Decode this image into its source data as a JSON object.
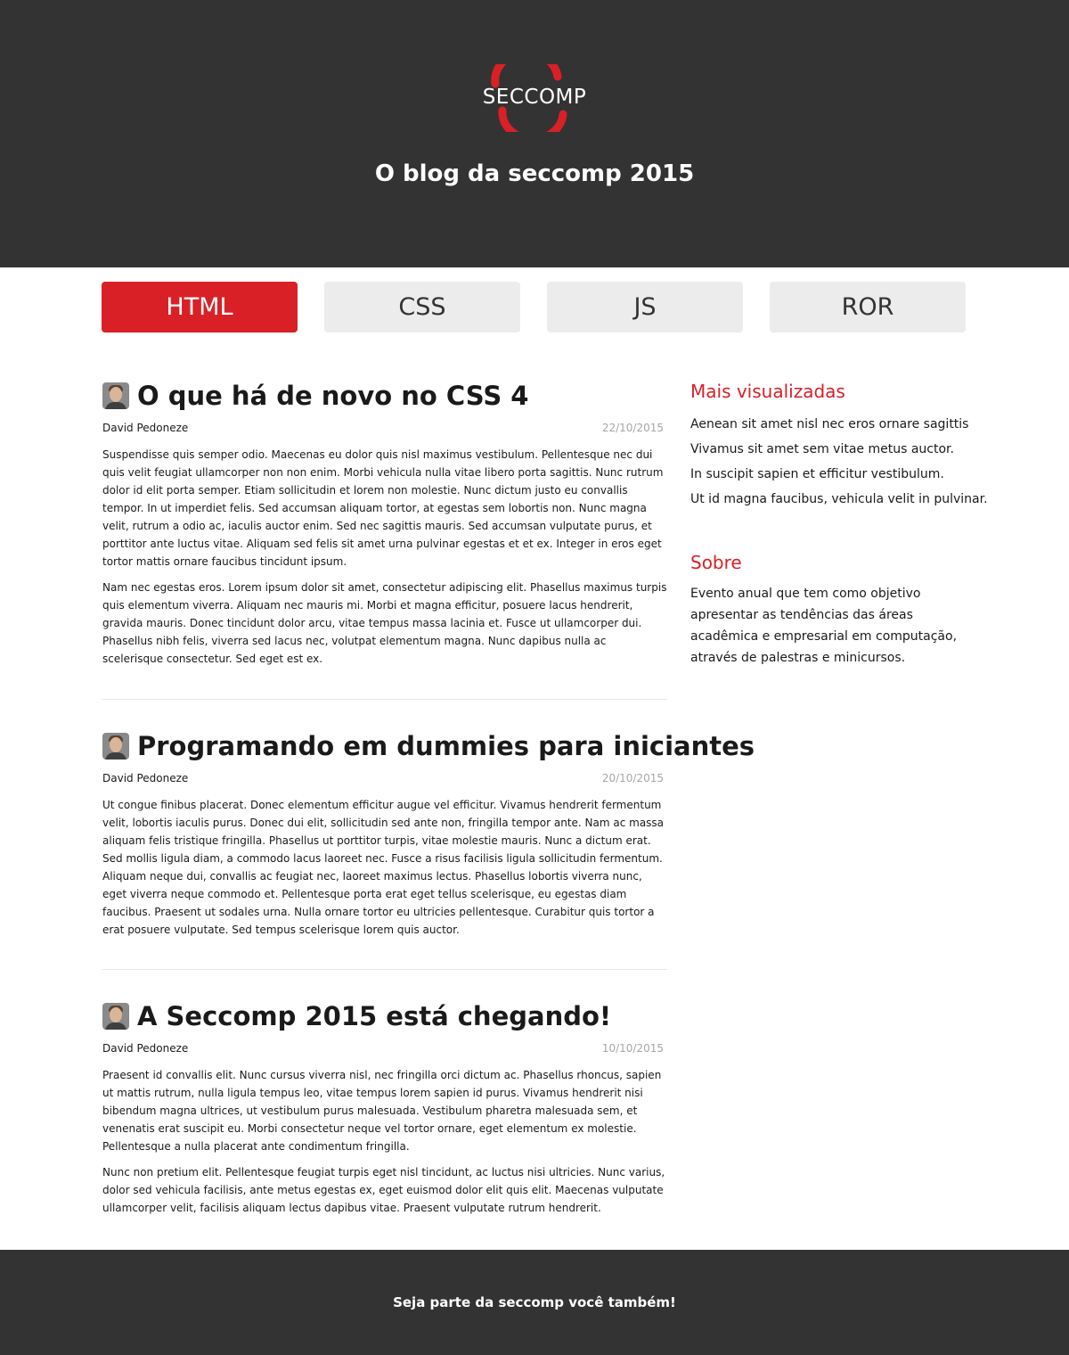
{
  "header": {
    "logo_text": "SECCOMP",
    "blog_title": "O blog da seccomp 2015"
  },
  "colors": {
    "accent": "#d92027",
    "dark": "#333333",
    "tab_inactive": "#ececec"
  },
  "nav": {
    "tabs": [
      {
        "label": "HTML",
        "active": true
      },
      {
        "label": "CSS",
        "active": false
      },
      {
        "label": "JS",
        "active": false
      },
      {
        "label": "ROR",
        "active": false
      }
    ]
  },
  "posts": [
    {
      "title": "O que há de novo no CSS 4",
      "author": "David Pedoneze",
      "date": "22/10/2015",
      "paragraphs": [
        "Suspendisse quis semper odio. Maecenas eu dolor quis nisl maximus vestibulum. Pellentesque nec dui quis velit feugiat ullamcorper non non enim. Morbi vehicula nulla vitae libero porta sagittis. Nunc rutrum dolor id elit porta semper. Etiam sollicitudin et lorem non molestie. Nunc dictum justo eu convallis tempor. In ut imperdiet felis. Sed accumsan aliquam tortor, at egestas sem lobortis non. Nunc magna velit, rutrum a odio ac, iaculis auctor enim. Sed nec sagittis mauris. Sed accumsan vulputate purus, et porttitor ante luctus vitae. Aliquam sed felis sit amet urna pulvinar egestas et et ex. Integer in eros eget tortor mattis ornare faucibus tincidunt ipsum.",
        "Nam nec egestas eros. Lorem ipsum dolor sit amet, consectetur adipiscing elit. Phasellus maximus turpis quis elementum viverra. Aliquam nec mauris mi. Morbi et magna efficitur, posuere lacus hendrerit, gravida mauris. Donec tincidunt dolor arcu, vitae tempus massa lacinia et. Fusce ut ullamcorper dui. Phasellus nibh felis, viverra sed lacus nec, volutpat elementum magna. Nunc dapibus nulla ac scelerisque consectetur. Sed eget est ex."
      ]
    },
    {
      "title": "Programando em dummies para iniciantes",
      "author": "David Pedoneze",
      "date": "20/10/2015",
      "paragraphs": [
        "Ut congue finibus placerat. Donec elementum efficitur augue vel efficitur. Vivamus hendrerit fermentum velit, lobortis iaculis purus. Donec dui elit, sollicitudin sed ante non, fringilla tempor ante. Nam ac massa aliquam felis tristique fringilla. Phasellus ut porttitor turpis, vitae molestie mauris. Nunc a dictum erat. Sed mollis ligula diam, a commodo lacus laoreet nec. Fusce a risus facilisis ligula sollicitudin fermentum. Aliquam neque dui, convallis ac feugiat nec, laoreet maximus lectus. Phasellus lobortis viverra nunc, eget viverra neque commodo et. Pellentesque porta erat eget tellus scelerisque, eu egestas diam faucibus. Praesent ut sodales urna. Nulla ornare tortor eu ultricies pellentesque. Curabitur quis tortor a erat posuere vulputate. Sed tempus scelerisque lorem quis auctor."
      ]
    },
    {
      "title": "A Seccomp 2015 está chegando!",
      "author": "David Pedoneze",
      "date": "10/10/2015",
      "paragraphs": [
        "Praesent id convallis elit. Nunc cursus viverra nisl, nec fringilla orci dictum ac. Phasellus rhoncus, sapien ut mattis rutrum, nulla ligula tempus leo, vitae tempus lorem sapien id purus. Vivamus hendrerit nisi bibendum magna ultrices, ut vestibulum purus malesuada. Vestibulum pharetra malesuada sem, et venenatis erat suscipit eu. Morbi consectetur neque vel tortor ornare, eget elementum ex molestie. Pellentesque a nulla placerat ante condimentum fringilla.",
        "Nunc non pretium elit. Pellentesque feugiat turpis eget nisl tincidunt, ac luctus nisi ultricies. Nunc varius, dolor sed vehicula facilisis, ante metus egestas ex, eget euismod dolor elit quis elit. Maecenas vulputate ullamcorper velit, facilisis aliquam lectus dapibus vitae. Praesent vulputate rutrum hendrerit."
      ]
    }
  ],
  "sidebar": {
    "most_viewed_title": "Mais visualizadas",
    "most_viewed": [
      "Aenean sit amet nisl nec eros ornare sagittis",
      "Vivamus sit amet sem vitae metus auctor.",
      "In suscipit sapien et efficitur vestibulum.",
      "Ut id magna faucibus, vehicula velit in pulvinar."
    ],
    "about_title": "Sobre",
    "about_text": "Evento anual que tem como objetivo apresentar as tendências das áreas acadêmica e empresarial em computação, através de palestras e minicursos."
  },
  "footer": {
    "text": "Seja parte da seccomp você também!"
  }
}
